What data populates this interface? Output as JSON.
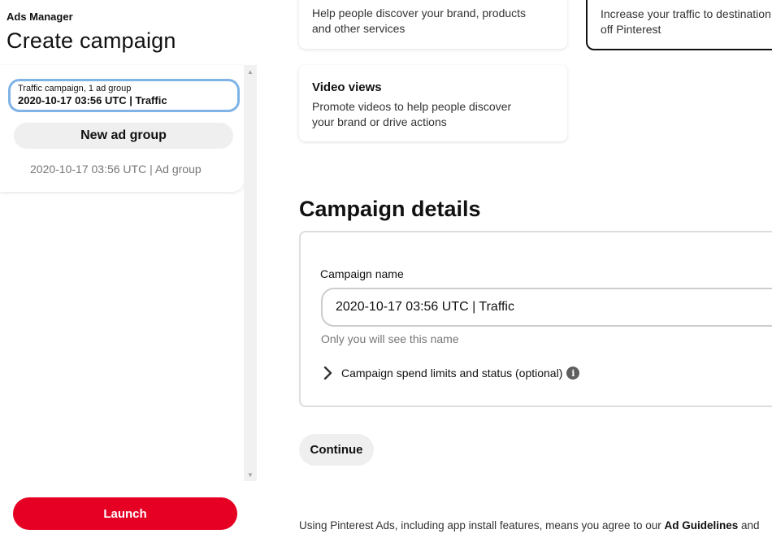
{
  "header": {
    "app_label": "Ads Manager",
    "page_title": "Create campaign"
  },
  "sidebar": {
    "campaign": {
      "subtitle": "Traffic campaign, 1 ad group",
      "name": "2020-10-17 03:56 UTC | Traffic"
    },
    "new_ad_group_label": "New ad group",
    "ad_groups": [
      {
        "label": "2020-10-17 03:56 UTC | Ad group"
      }
    ],
    "launch_label": "Launch"
  },
  "objectives": [
    {
      "title": "",
      "description": "Help people discover your brand, products and other services"
    },
    {
      "title": "",
      "description": "Increase your traffic to destination\noff Pinterest",
      "selected": true
    },
    {
      "title": "Video views",
      "description": "Promote videos to help people discover your brand or drive actions"
    }
  ],
  "campaign_details": {
    "title": "Campaign details",
    "name_label": "Campaign name",
    "name_value": "2020-10-17 03:56 UTC | Traffic",
    "name_help": "Only you will see this name",
    "spend_limits_label": "Campaign spend limits and status (optional)"
  },
  "continue_label": "Continue",
  "footer": {
    "text_prefix": "Using Pinterest Ads, including app install features, means you agree to our ",
    "link_ad_guidelines": "Ad Guidelines",
    "text_suffix": " and"
  },
  "colors": {
    "brand_red": "#e60023",
    "selected_outline": "#7fb3e6"
  }
}
